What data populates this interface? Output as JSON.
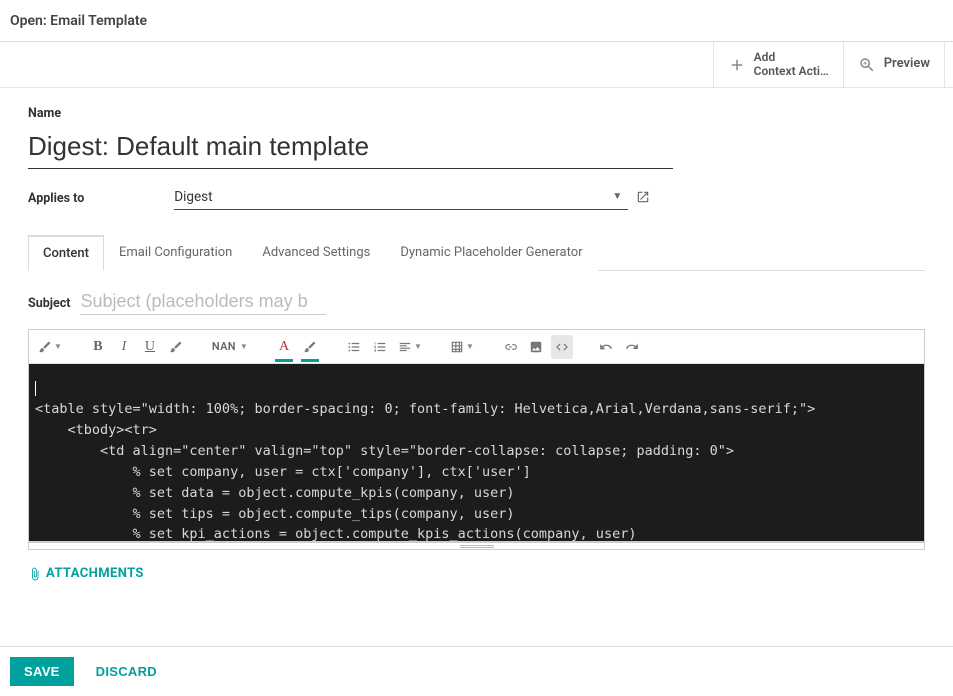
{
  "header": {
    "title": "Open: Email Template"
  },
  "actions": {
    "add": {
      "line1": "Add",
      "line2": "Context Acti…"
    },
    "preview": {
      "label": "Preview"
    }
  },
  "form": {
    "name_label": "Name",
    "name_value": "Digest: Default main template",
    "applies_label": "Applies to",
    "applies_value": "Digest"
  },
  "tabs": [
    {
      "label": "Content",
      "active": true
    },
    {
      "label": "Email Configuration",
      "active": false
    },
    {
      "label": "Advanced Settings",
      "active": false
    },
    {
      "label": "Dynamic Placeholder Generator",
      "active": false
    }
  ],
  "subject": {
    "label": "Subject",
    "placeholder": "Subject (placeholders may b"
  },
  "toolbar": {
    "size_label": "NAN"
  },
  "code": "\n<table style=\"width: 100%; border-spacing: 0; font-family: Helvetica,Arial,Verdana,sans-serif;\">\n    <tbody><tr>\n        <td align=\"center\" valign=\"top\" style=\"border-collapse: collapse; padding: 0\">\n            % set company, user = ctx['company'], ctx['user']\n            % set data = object.compute_kpis(company, user)\n            % set tips = object.compute_tips(company, user)\n            % set kpi_actions = object.compute_kpis_actions(company, user)",
  "attachments": {
    "label": "ATTACHMENTS"
  },
  "footer": {
    "save": "SAVE",
    "discard": "DISCARD"
  }
}
